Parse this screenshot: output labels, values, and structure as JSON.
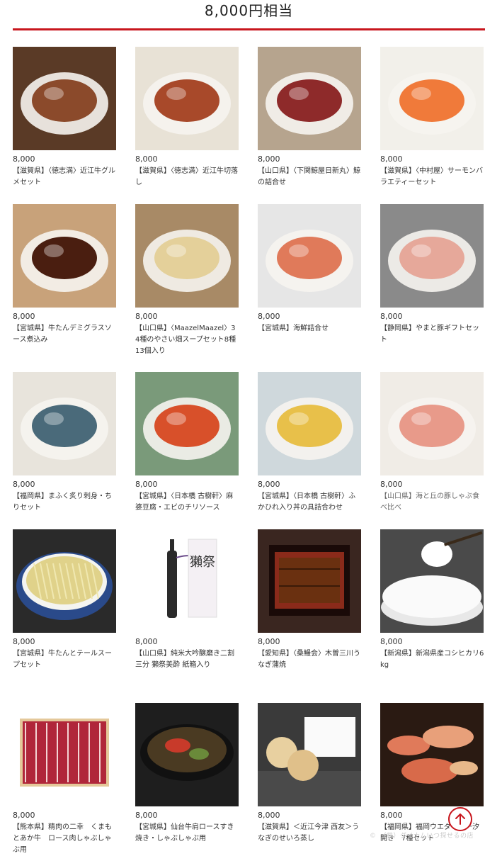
{
  "header": {
    "title": "8,000円相当"
  },
  "items": [
    {
      "price": "8,000",
      "name": "【滋賀県】〈徳志満〉近江牛グルメセット",
      "icon": "hamburg-steak",
      "bg": "#5a3a26",
      "accent": "#8b4a2b"
    },
    {
      "price": "8,000",
      "name": "【滋賀県】〈徳志満〉近江牛切落し",
      "icon": "beef-bowl",
      "bg": "#e8e2d6",
      "accent": "#a8492a"
    },
    {
      "price": "8,000",
      "name": "【山口県】〈下関鯨屋日新丸〉鯨の詰合せ",
      "icon": "whale-platter",
      "bg": "#b6a48e",
      "accent": "#8e2a2a"
    },
    {
      "price": "8,000",
      "name": "【滋賀県】〈中村屋〉サーモンバラエティーセット",
      "icon": "salmon-packs",
      "bg": "#f2f0ea",
      "accent": "#f07a3a"
    },
    {
      "price": "8,000",
      "name": "【宮城県】牛たんデミグラスソース煮込み",
      "icon": "stew-plate",
      "bg": "#c8a27a",
      "accent": "#4a1e10"
    },
    {
      "price": "8,000",
      "name": "【山口県】〈MaazelMaazel〉34種のやさい畑スープセット8種13個入り",
      "icon": "soup-cups",
      "bg": "#a88a66",
      "accent": "#e4d09a"
    },
    {
      "price": "8,000",
      "name": "【宮城県】海鮮詰合せ",
      "icon": "seafood-set",
      "bg": "#e6e6e6",
      "accent": "#e07a5a"
    },
    {
      "price": "8,000",
      "name": "【静岡県】やまと豚ギフトセット",
      "icon": "ham-sausage",
      "bg": "#8a8a8a",
      "accent": "#e6a89a"
    },
    {
      "price": "8,000",
      "name": "【福岡県】まふく炙り刺身・ちりセット",
      "icon": "fugu-sashimi",
      "bg": "#e8e4dc",
      "accent": "#4a6a7a"
    },
    {
      "price": "8,000",
      "name": "【宮城県】〈日本橋 古樹軒〉麻婆豆腐・エビのチリソース",
      "icon": "mapo-shrimp",
      "bg": "#7a9a7a",
      "accent": "#d8502a"
    },
    {
      "price": "8,000",
      "name": "【宮城県】〈日本橋 古樹軒〉ふかひれ入り丼の具詰合わせ",
      "icon": "shark-fin-bowl",
      "bg": "#cfd8dc",
      "accent": "#e8c04a"
    },
    {
      "price": "8,000",
      "name": "【山口県】海と丘の豚しゃぶ食べ比べ",
      "icon": "shabu-set",
      "bg": "#f0ece6",
      "accent": "#e89a8a",
      "muted": true
    },
    {
      "price": "8,000",
      "name": "【宮城県】牛たんとテールスープセット",
      "icon": "tail-soup",
      "bg": "#2a2a2a",
      "accent": "#e0d28a"
    },
    {
      "price": "8,000",
      "name": "【山口県】純米大吟醸磨き二割三分 獺祭美酔 紙箱入り",
      "icon": "sake-bottle",
      "bg": "#ffffff",
      "accent": "#6a4a8a",
      "label": "獺祭"
    },
    {
      "price": "8,000",
      "name": "【愛知県】〈桑鰻会〉木曽三川うなぎ蒲焼",
      "icon": "unagi-box",
      "bg": "#3a2620",
      "accent": "#8a2a1a"
    },
    {
      "price": "8,000",
      "name": "【新潟県】新潟県産コシヒカリ6kg",
      "icon": "rice-bowl",
      "bg": "#4a4a4a",
      "accent": "#ffffff"
    },
    {
      "price": "8,000",
      "name": "【熊本県】精肉の二幸　くまもとあか牛　ロース肉しゃぶしゃぶ用",
      "icon": "beef-slices",
      "bg": "#ffffff",
      "accent": "#b0263a"
    },
    {
      "price": "8,000",
      "name": "【宮城県】仙台牛肩ロースすき焼き・しゃぶしゃぶ用",
      "icon": "sukiyaki-pot",
      "bg": "#1e1e1e",
      "accent": "#c83a2a"
    },
    {
      "price": "8,000",
      "name": "【滋賀県】＜近江今津 西友＞うなぎのせいろ蒸し",
      "icon": "seiro-box",
      "bg": "#3a3a3a",
      "accent": "#e8d0a0"
    },
    {
      "price": "8,000",
      "name": "【福岡県】福岡ウエダ　鮮一汐開き　7種セット",
      "icon": "dried-fish",
      "bg": "#2a1a12",
      "accent": "#e07a5a"
    }
  ],
  "back_to_top": {
    "icon": "arrow-up-icon"
  },
  "watermark": {
    "text": "©　（株）ダイナムいつ探せるの店"
  }
}
